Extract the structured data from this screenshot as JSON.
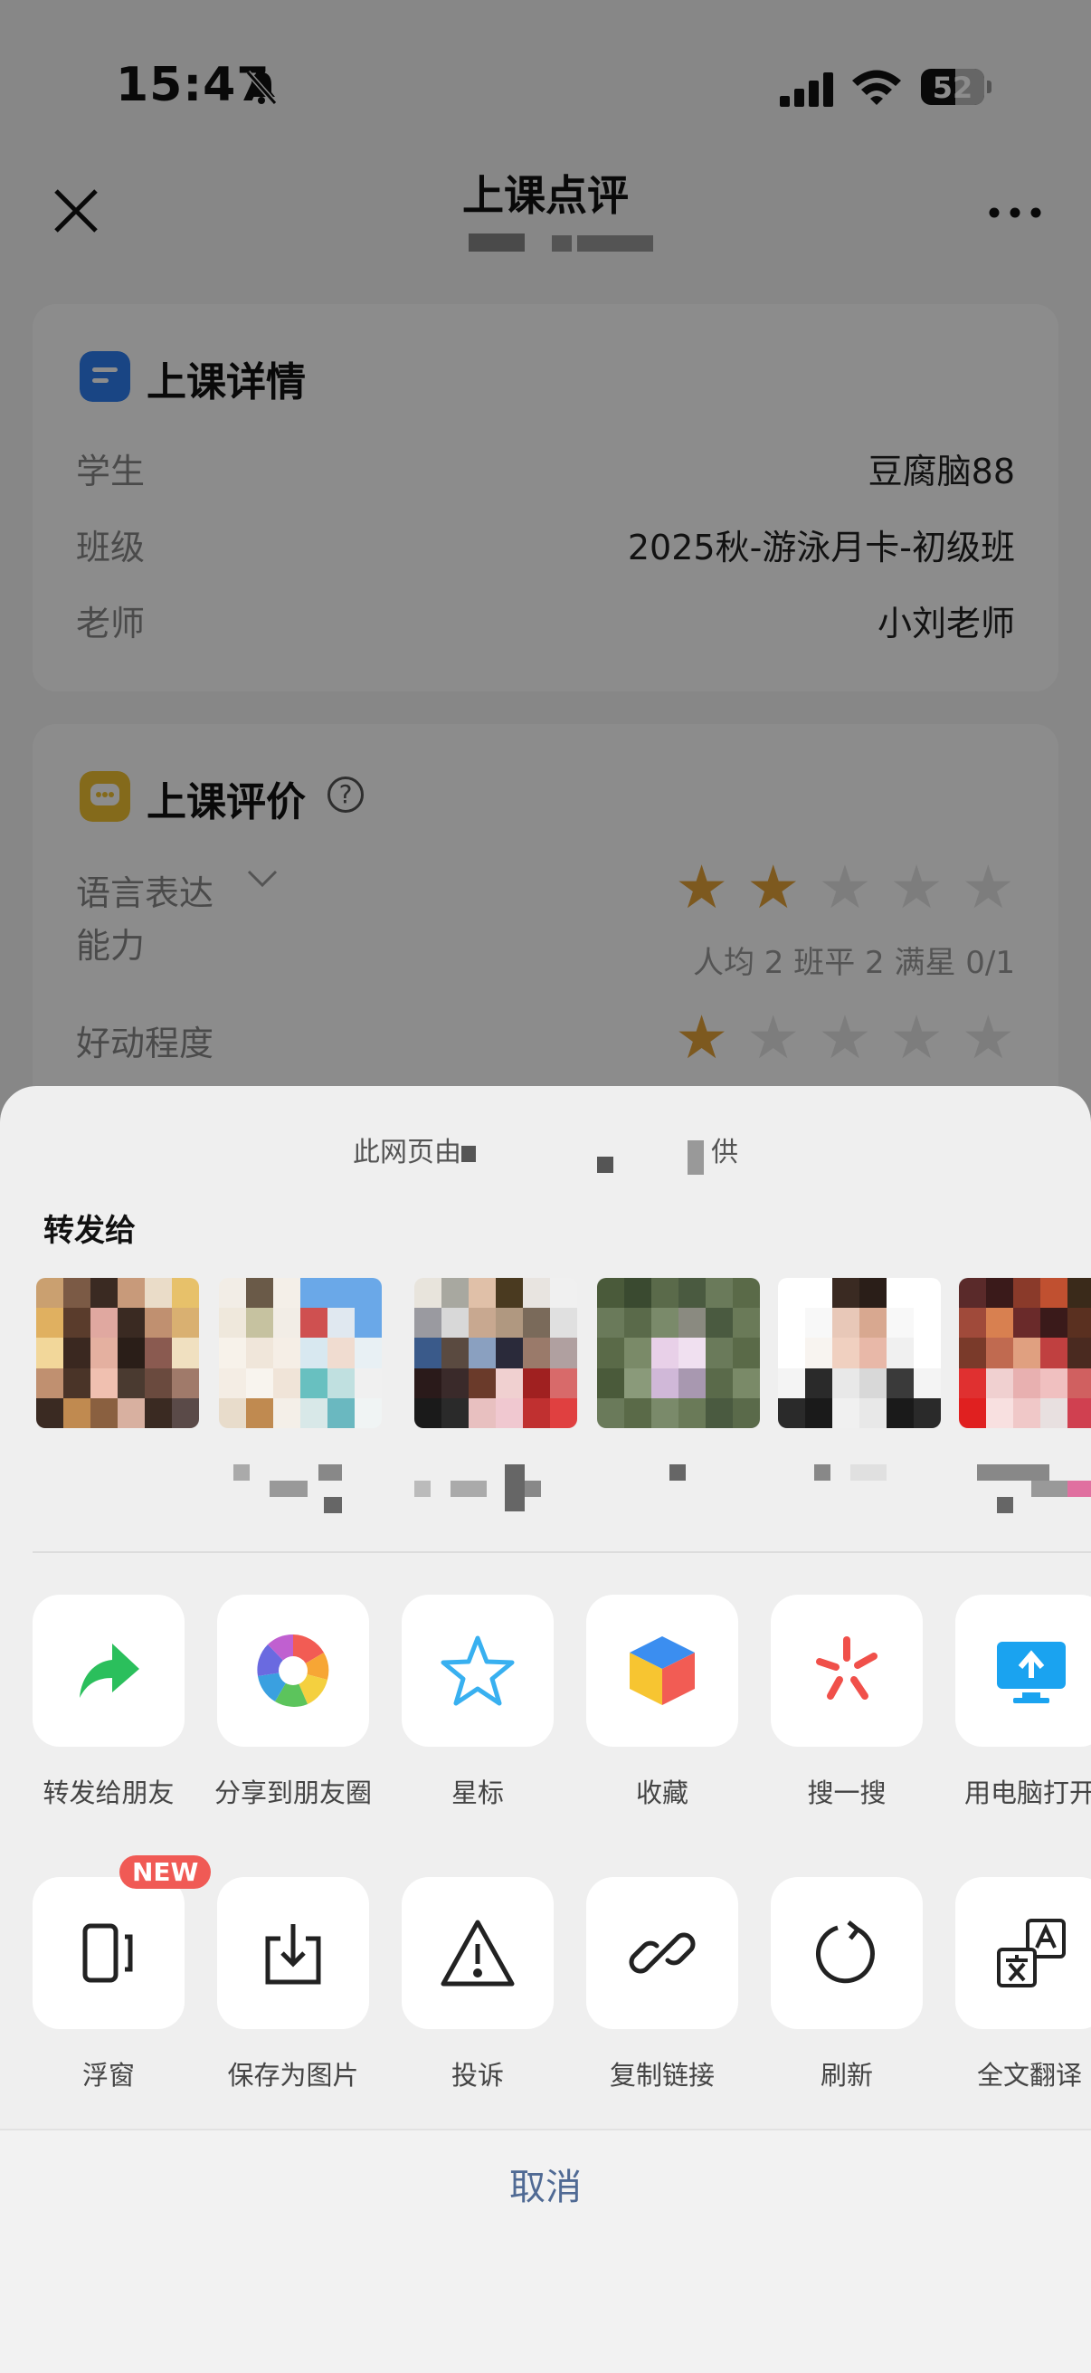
{
  "status_bar": {
    "time": "15:47",
    "battery": "52"
  },
  "header": {
    "title": "上课点评"
  },
  "details_card": {
    "title": "上课详情",
    "rows": [
      {
        "label": "学生",
        "value": "豆腐脑88"
      },
      {
        "label": "班级",
        "value": "2025秋-游泳月卡-初级班"
      },
      {
        "label": "老师",
        "value": "小刘老师"
      }
    ]
  },
  "evaluation_card": {
    "title": "上课评价",
    "help": "?",
    "items": [
      {
        "label_line1": "语言表达",
        "label_line2": "能力",
        "stars": 2,
        "max": 5,
        "stats": "人均 2   班平 2   满星 0/1"
      },
      {
        "label_line1": "好动程度",
        "label_line2": "",
        "stars": 1,
        "max": 5,
        "stats": ""
      }
    ]
  },
  "sheet": {
    "provider_text": "此网页由",
    "provider_suffix": "供",
    "forward_to": "转发给",
    "actions_row1": [
      {
        "label": "转发给朋友",
        "icon": "forward-arrow-icon"
      },
      {
        "label": "分享到朋友圈",
        "icon": "moments-icon"
      },
      {
        "label": "星标",
        "icon": "star-icon"
      },
      {
        "label": "收藏",
        "icon": "favorite-cube-icon"
      },
      {
        "label": "搜一搜",
        "icon": "search-sparkle-icon"
      },
      {
        "label": "用电脑打开",
        "icon": "open-on-pc-icon"
      }
    ],
    "actions_row2": [
      {
        "label": "浮窗",
        "icon": "float-window-icon",
        "badge": "NEW"
      },
      {
        "label": "保存为图片",
        "icon": "save-image-icon"
      },
      {
        "label": "投诉",
        "icon": "warning-icon"
      },
      {
        "label": "复制链接",
        "icon": "link-icon"
      },
      {
        "label": "刷新",
        "icon": "refresh-icon"
      },
      {
        "label": "全文翻译",
        "icon": "translate-icon"
      }
    ],
    "cancel": "取消"
  }
}
